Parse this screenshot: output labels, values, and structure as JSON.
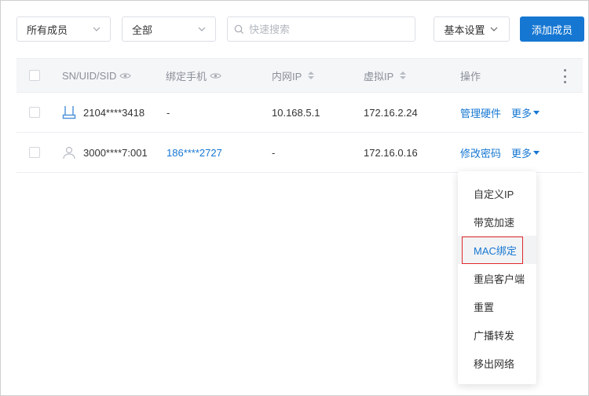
{
  "toolbar": {
    "member_filter": "所有成员",
    "scope_filter": "全部",
    "search_placeholder": "快速搜索",
    "settings_label": "基本设置",
    "add_member_label": "添加成员"
  },
  "table": {
    "columns": {
      "sn": "SN/UID/SID",
      "phone": "绑定手机",
      "lan_ip": "内网IP",
      "virtual_ip": "虚拟IP",
      "actions": "操作"
    },
    "rows": [
      {
        "device_icon": "router-icon",
        "sn": "2104****3418",
        "phone": "-",
        "lan_ip": "10.168.5.1",
        "virtual_ip": "172.16.2.24",
        "action": "管理硬件",
        "more": "更多"
      },
      {
        "device_icon": "user-icon",
        "sn": "3000****7:001",
        "phone": "186****2727",
        "lan_ip": "-",
        "virtual_ip": "172.16.0.16",
        "action": "修改密码",
        "more": "更多"
      }
    ]
  },
  "dropdown": {
    "items": [
      "自定义IP",
      "带宽加速",
      "MAC绑定",
      "重启客户端",
      "重置",
      "广播转发",
      "移出网络"
    ],
    "active_index": 2
  },
  "colors": {
    "primary": "#1677d2",
    "highlight_border": "#e0292b",
    "header_bg": "#f5f6f8"
  }
}
